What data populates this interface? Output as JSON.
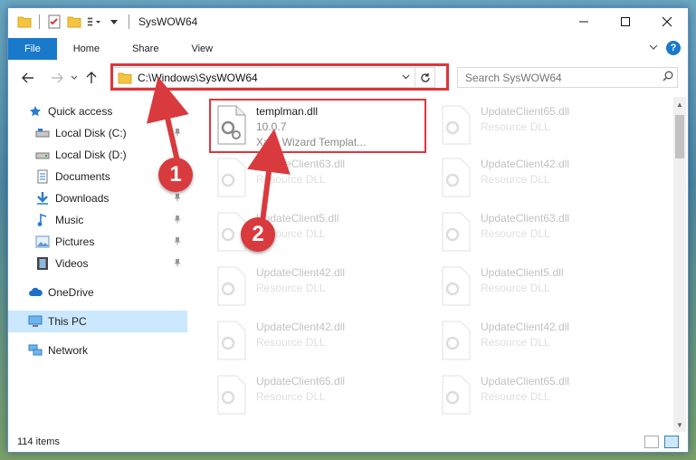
{
  "window": {
    "title": "SysWOW64"
  },
  "ribbon": {
    "tabs": [
      {
        "label": "File"
      },
      {
        "label": "Home"
      },
      {
        "label": "Share"
      },
      {
        "label": "View"
      }
    ],
    "help": "?"
  },
  "navbar": {
    "address": "C:\\Windows\\SysWOW64",
    "search_placeholder": "Search SysWOW64"
  },
  "sidebar": {
    "items": [
      {
        "label": "Quick access",
        "icon": "star-icon"
      },
      {
        "label": "Local Disk (C:)",
        "icon": "drive-icon"
      },
      {
        "label": "Local Disk (D:)",
        "icon": "drive-icon"
      },
      {
        "label": "Documents",
        "icon": "documents-icon"
      },
      {
        "label": "Downloads",
        "icon": "downloads-icon"
      },
      {
        "label": "Music",
        "icon": "music-icon"
      },
      {
        "label": "Pictures",
        "icon": "pictures-icon"
      },
      {
        "label": "Videos",
        "icon": "videos-icon"
      },
      {
        "label": "OneDrive",
        "icon": "cloud-icon"
      },
      {
        "label": "This PC",
        "icon": "computer-icon"
      },
      {
        "label": "Network",
        "icon": "network-icon"
      }
    ]
  },
  "files": [
    {
      "name": "templman.dll",
      "line2": "10.0.7",
      "line3": "Xara Wizard Templat..."
    },
    {
      "name": "UpdateClient65.dll",
      "line2": "Resource DLL"
    },
    {
      "name": "UpdateClient63.dll",
      "line2": "Resource DLL"
    },
    {
      "name": "UpdateClient42.dll",
      "line2": "Resource DLL"
    },
    {
      "name": "UpdateClient5.dll",
      "line2": "Resource DLL"
    },
    {
      "name": "UpdateClient63.dll",
      "line2": "Resource DLL"
    },
    {
      "name": "UpdateClient42.dll",
      "line2": "Resource DLL"
    },
    {
      "name": "UpdateClient5.dll",
      "line2": "Resource DLL"
    },
    {
      "name": "UpdateClient42.dll",
      "line2": "Resource DLL"
    },
    {
      "name": "UpdateClient42.dll",
      "line2": "Resource DLL"
    },
    {
      "name": "UpdateClient65.dll",
      "line2": "Resource DLL"
    },
    {
      "name": "UpdateClient65.dll",
      "line2": "Resource DLL"
    }
  ],
  "status": {
    "count": "114 items"
  },
  "annotations": {
    "step1": "1",
    "step2": "2",
    "color": "#d93a3d"
  }
}
